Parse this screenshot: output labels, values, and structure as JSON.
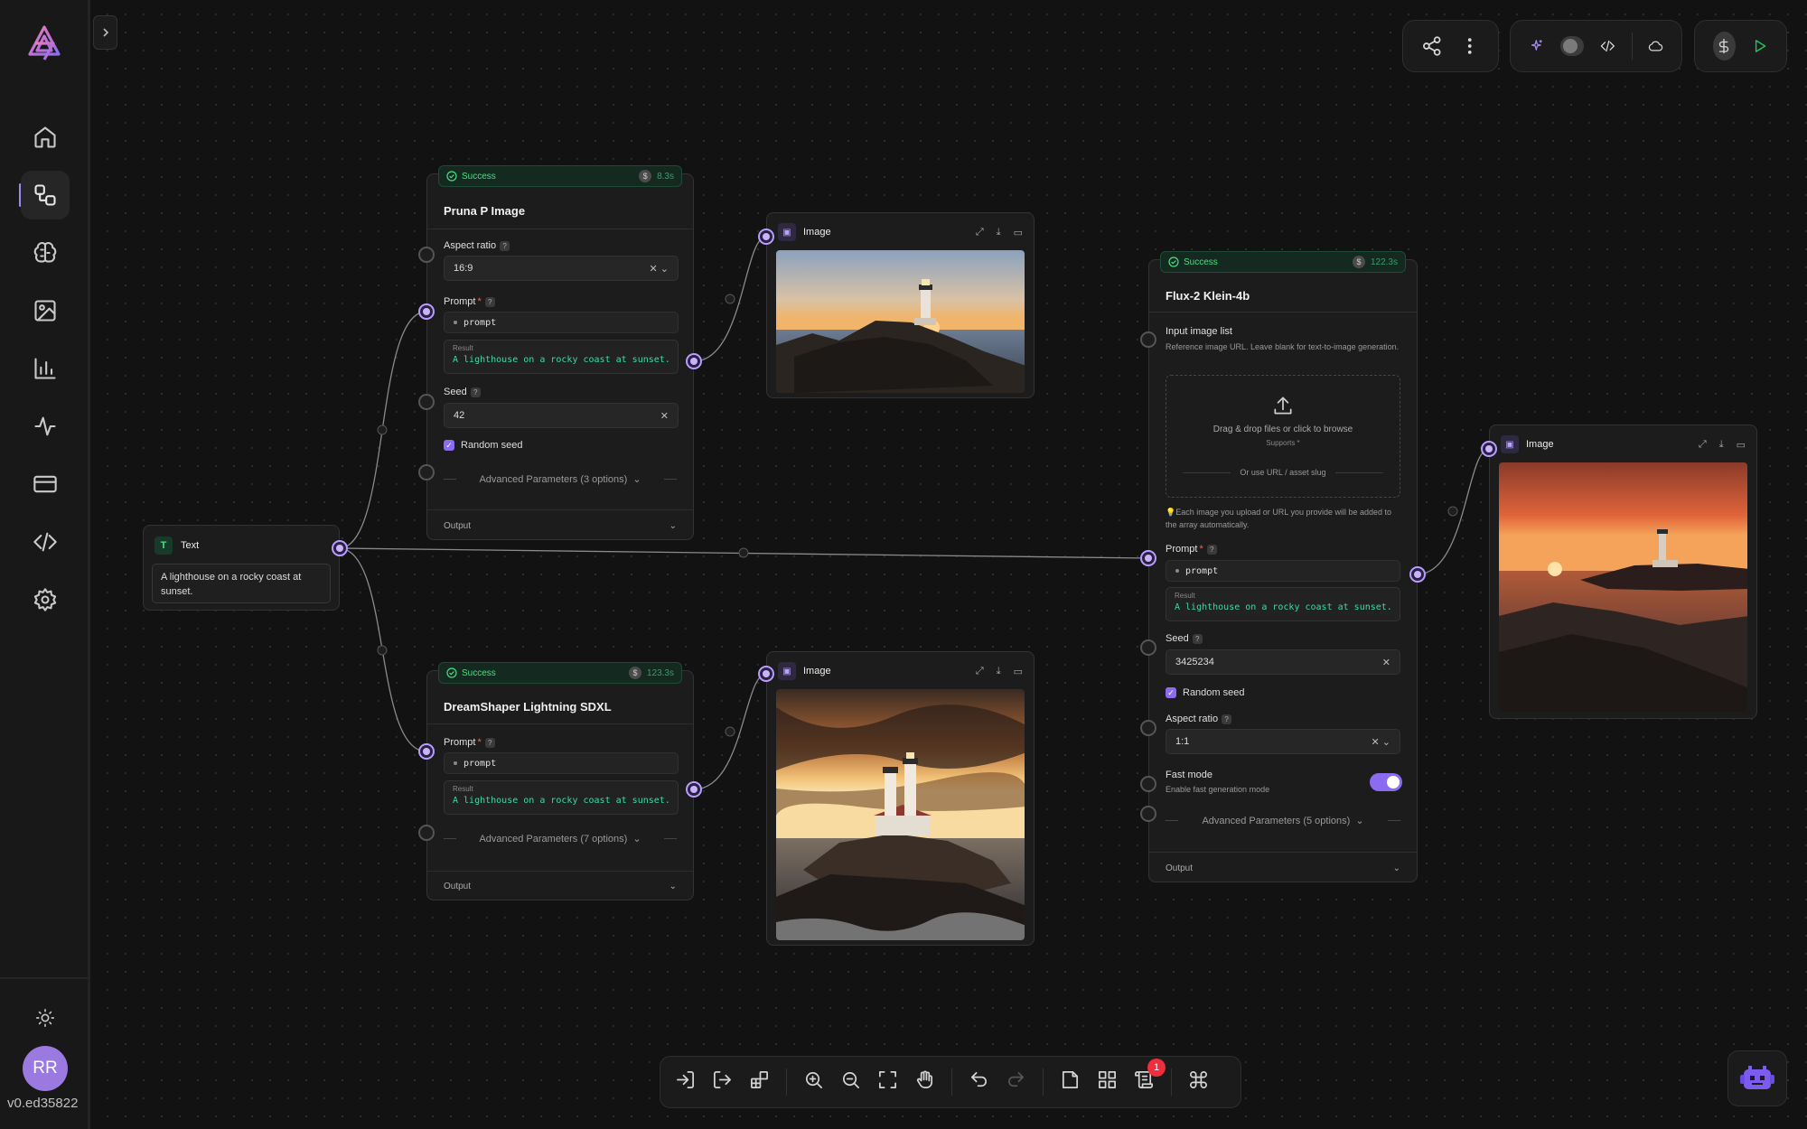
{
  "app": {
    "version": "v0.ed35822",
    "user_initials": "RR"
  },
  "sidebar": {
    "items": [
      {
        "name": "home",
        "icon": "home-icon"
      },
      {
        "name": "workflows",
        "icon": "workflow-icon",
        "active": true
      },
      {
        "name": "models",
        "icon": "brain-icon"
      },
      {
        "name": "gallery",
        "icon": "image-icon"
      },
      {
        "name": "analytics",
        "icon": "bar-chart-icon"
      },
      {
        "name": "activity",
        "icon": "activity-icon"
      },
      {
        "name": "billing",
        "icon": "credit-card-icon"
      },
      {
        "name": "api",
        "icon": "code-icon"
      },
      {
        "name": "settings",
        "icon": "gear-icon"
      }
    ]
  },
  "nodes": {
    "text": {
      "title": "Text",
      "value": "A lighthouse on a rocky coast at sunset."
    },
    "pruna": {
      "status": "Success",
      "time": "8.3s",
      "title": "Pruna P Image",
      "aspect_label": "Aspect ratio",
      "aspect_value": "16:9",
      "prompt_label": "Prompt",
      "prompt_pill": "prompt",
      "result_label": "Result",
      "result_value": "A lighthouse on a rocky coast at sunset.",
      "seed_label": "Seed",
      "seed_value": "42",
      "random_seed": "Random seed",
      "advanced": "Advanced Parameters (3 options)",
      "output": "Output"
    },
    "dreamshaper": {
      "status": "Success",
      "time": "123.3s",
      "title": "DreamShaper Lightning SDXL",
      "prompt_label": "Prompt",
      "prompt_pill": "prompt",
      "result_label": "Result",
      "result_value": "A lighthouse on a rocky coast at sunset.",
      "advanced": "Advanced Parameters (7 options)",
      "output": "Output"
    },
    "flux": {
      "status": "Success",
      "time": "122.3s",
      "title": "Flux-2 Klein-4b",
      "input_label": "Input image list",
      "input_desc": "Reference image URL. Leave blank for text-to-image generation.",
      "upload_text": "Drag & drop files or click to browse",
      "supports": "Supports *",
      "url_text": "Or use URL / asset slug",
      "upload_note": "💡Each image you upload or URL you provide will be added to the array automatically.",
      "prompt_label": "Prompt",
      "prompt_pill": "prompt",
      "result_label": "Result",
      "result_value": "A lighthouse on a rocky coast at sunset.",
      "seed_label": "Seed",
      "seed_value": "3425234",
      "random_seed": "Random seed",
      "aspect_label": "Aspect ratio",
      "aspect_value": "1:1",
      "fast_label": "Fast mode",
      "fast_desc": "Enable fast generation mode",
      "advanced": "Advanced Parameters (5 options)",
      "output": "Output"
    },
    "image1": {
      "title": "Image"
    },
    "image2": {
      "title": "Image"
    },
    "image3": {
      "title": "Image"
    }
  },
  "colors": {
    "accent": "#8b6cf0",
    "success": "#4ade80",
    "result_text": "#3fd9a4",
    "badge": "#ef2d3c"
  },
  "bottombar": {
    "notification_count": "1"
  }
}
